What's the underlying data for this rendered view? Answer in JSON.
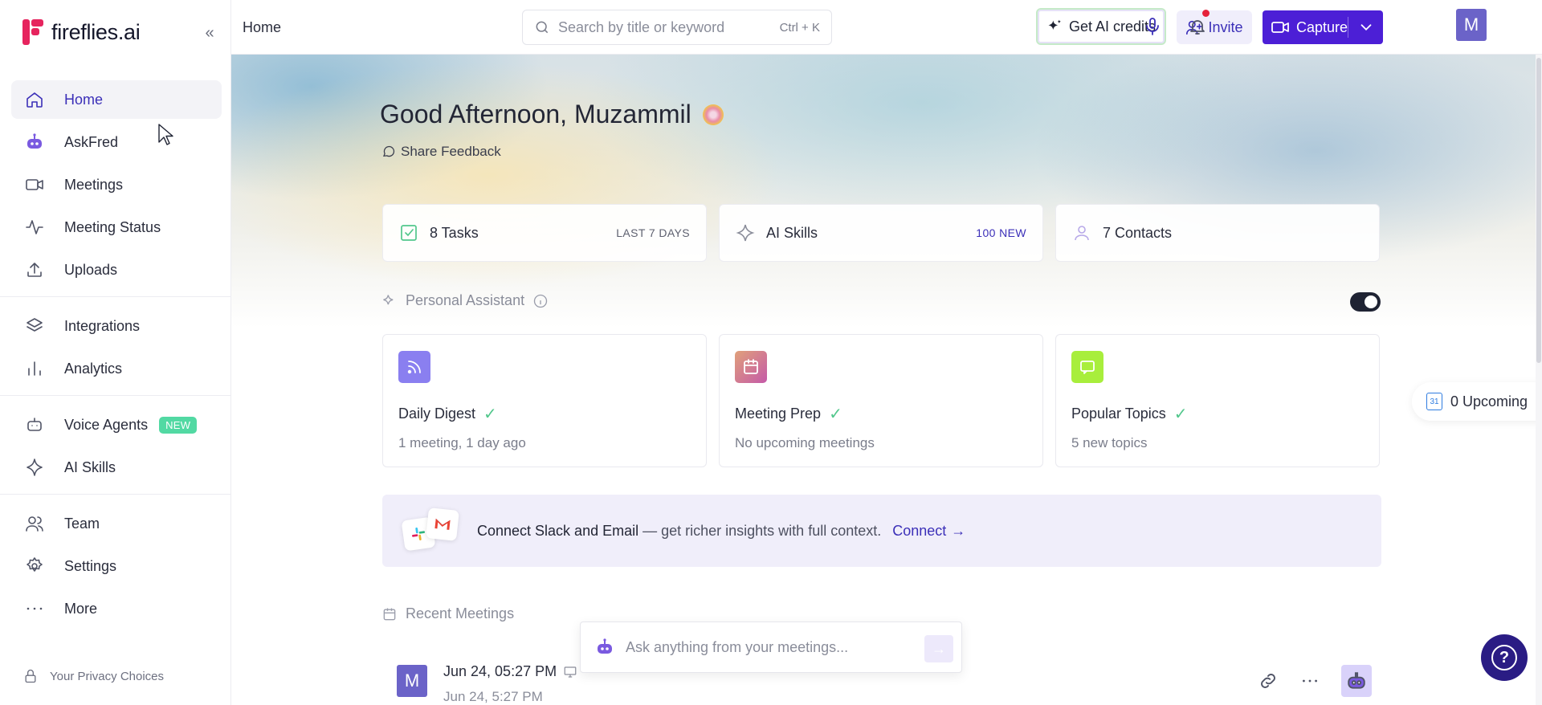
{
  "brand": {
    "name": "fireflies.ai"
  },
  "sidebar": {
    "items": [
      {
        "label": "Home",
        "icon": "home-icon",
        "active": true
      },
      {
        "label": "AskFred",
        "icon": "askfred-robot-icon"
      },
      {
        "label": "Meetings",
        "icon": "video-camera-icon"
      },
      {
        "label": "Meeting Status",
        "icon": "activity-icon"
      },
      {
        "label": "Uploads",
        "icon": "upload-icon"
      },
      {
        "label": "Integrations",
        "icon": "layers-icon"
      },
      {
        "label": "Analytics",
        "icon": "bar-chart-icon"
      },
      {
        "label": "Voice Agents",
        "icon": "bot-icon",
        "badge": "NEW"
      },
      {
        "label": "AI Skills",
        "icon": "sparkle-icon"
      },
      {
        "label": "Team",
        "icon": "users-icon"
      },
      {
        "label": "Settings",
        "icon": "gear-icon"
      },
      {
        "label": "More",
        "icon": "more-dots-icon"
      }
    ],
    "privacy": "Your Privacy Choices"
  },
  "header": {
    "breadcrumb": "Home",
    "search_placeholder": "Search by title or keyword",
    "search_shortcut": "Ctrl + K",
    "credits_label": "Get AI credits",
    "invite_label": "Invite",
    "capture_label": "Capture",
    "avatar_initial": "M"
  },
  "main": {
    "greeting": "Good Afternoon, Muzammil",
    "feedback": "Share Feedback",
    "stats": [
      {
        "label": "8 Tasks",
        "meta": "LAST 7 DAYS",
        "icon": "checkbox-icon"
      },
      {
        "label": "AI Skills",
        "meta": "100 NEW",
        "icon": "sparkle-icon"
      },
      {
        "label": "7 Contacts",
        "meta": "",
        "icon": "user-icon"
      }
    ],
    "personal_assistant": {
      "heading": "Personal Assistant",
      "enabled": true,
      "cards": [
        {
          "title": "Daily Digest",
          "subtitle": "1 meeting, 1 day ago",
          "icon": "rss-icon",
          "color": "#8a7ff0"
        },
        {
          "title": "Meeting Prep",
          "subtitle": "No upcoming meetings",
          "icon": "calendar-icon",
          "color": "#d36aa8"
        },
        {
          "title": "Popular Topics",
          "subtitle": "5 new topics",
          "icon": "chat-bubble-icon",
          "color": "#a8ee3c"
        }
      ]
    },
    "upcoming": "0 Upcoming",
    "connect": {
      "strong": "Connect Slack and Email",
      "rest": " — get richer insights with full context.",
      "link": "Connect"
    },
    "recent_meetings": {
      "heading": "Recent Meetings",
      "rows": [
        {
          "avatar": "M",
          "title": "Jun 24, 05:27 PM",
          "subtitle": "Jun 24, 5:27 PM"
        }
      ]
    },
    "ask_placeholder": "Ask anything from your meetings..."
  }
}
